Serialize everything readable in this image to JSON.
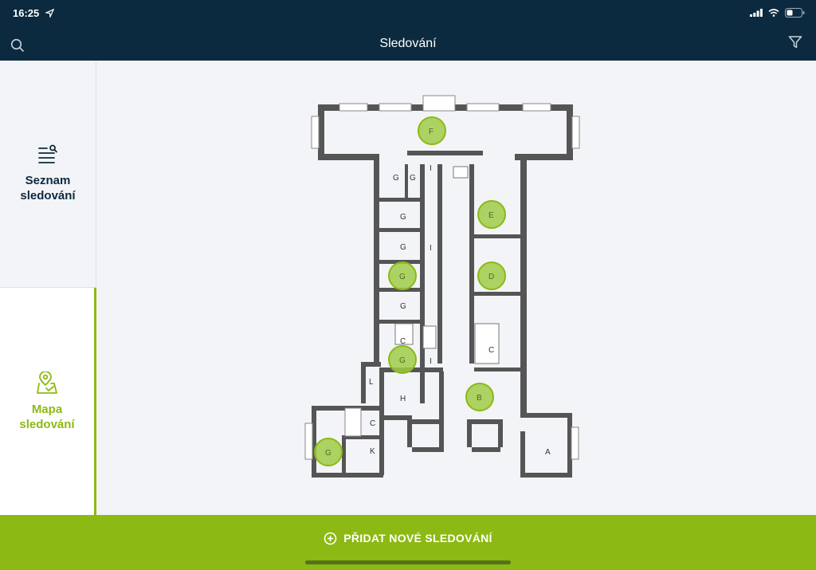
{
  "status": {
    "time": "16:25"
  },
  "header": {
    "title": "Sledování"
  },
  "sidebar": {
    "list_tab": {
      "label_line1": "Seznam",
      "label_line2": "sledování"
    },
    "map_tab": {
      "label_line1": "Mapa",
      "label_line2": "sledování"
    }
  },
  "floorplan": {
    "room_labels": [
      "G",
      "G",
      "G",
      "G",
      "G",
      "C",
      "I",
      "I",
      "I",
      "C",
      "H",
      "L",
      "C",
      "K",
      "A"
    ],
    "markers": [
      {
        "label": "F",
        "color": "#9fcb4a"
      },
      {
        "label": "E",
        "color": "#9fcb4a"
      },
      {
        "label": "D",
        "color": "#9fcb4a"
      },
      {
        "label": "G",
        "color": "#9fcb4a"
      },
      {
        "label": "G",
        "color": "#9fcb4a"
      },
      {
        "label": "B",
        "color": "#9fcb4a"
      },
      {
        "label": "G",
        "color": "#9fcb4a"
      }
    ]
  },
  "bottom": {
    "add_label": "PŘIDAT NOVÉ SLEDOVÁNÍ"
  },
  "colors": {
    "header_bg": "#0c2a3f",
    "accent": "#8cb913",
    "map_bg": "#f3f4f7"
  }
}
